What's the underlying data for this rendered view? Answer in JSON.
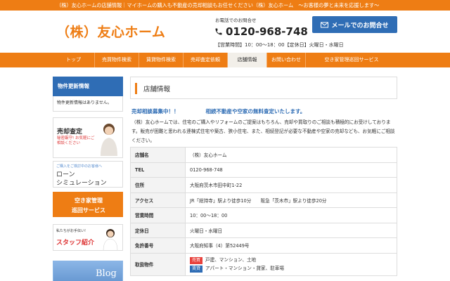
{
  "topbar": {
    "text": "（株）友心ホームの店舗情報｜マイホームの購入も不動産の売却相談もお任せください（株）友心ホーム　～お客様の夢と未来を応援します～"
  },
  "header": {
    "logo": "（株）友心ホーム",
    "tel_label": "お電話でのお問合せ",
    "tel": "0120-968-748",
    "hours": "【営業時間】10：00～18：00【定休日】火曜日・水曜日",
    "mail_button": "メールでのお問合せ"
  },
  "nav": {
    "items": [
      {
        "label": "トップ"
      },
      {
        "label": "売買物件検索"
      },
      {
        "label": "賃貸物件検索"
      },
      {
        "label": "売却査定依頼"
      },
      {
        "label": "店舗情報"
      },
      {
        "label": "お問い合わせ"
      },
      {
        "label": "空き家管理巡回サービス"
      }
    ],
    "active_index": 4
  },
  "sidebar": {
    "update_title": "物件更新情報",
    "update_body": "物件更新情報はありません。",
    "sale_title": "売却査定",
    "sale_sub": "秘密厳守! お気軽にご相談ください",
    "loan_note": "ご購入をご検討中のお客様へ",
    "loan_line1": "ローン",
    "loan_line2": "シミュレーション",
    "akiya_line1": "空き家管理",
    "akiya_line2": "巡回サービス",
    "staff_note": "私たちがお手伝い!",
    "staff_title": "スタッフ紹介",
    "blog_title": "Blog"
  },
  "main": {
    "title": "店舗情報",
    "lead_left": "売却相談募集中！！",
    "lead_right": "相続不動産や空家の無料査定いたします。",
    "description": "（株）友心ホームでは、住宅のご購入やリフォームのご提案はもちろん、売却や買取りのご相談も積極的にお受けしております。販売が困難と思われる連棟式住宅や築古、狭小住宅、また、相続登記が必要な不動産や空家の売却なども、お気軽にご相談ください。",
    "rows": [
      {
        "key": "店舗名",
        "value": "（株）友心ホーム"
      },
      {
        "key": "TEL",
        "value": "0120-968-748"
      },
      {
        "key": "住所",
        "value": "大阪府茨木市田中町1-22"
      },
      {
        "key": "アクセス",
        "value": "JR「総持寺」駅より徒歩10分　　阪急「茨木市」駅より徒歩20分"
      },
      {
        "key": "営業時間",
        "value": "10：00～18：00"
      },
      {
        "key": "定休日",
        "value": "火曜日・水曜日"
      },
      {
        "key": "免許番号",
        "value": "大阪府知事（4）第52449号"
      }
    ],
    "handling_key": "取扱物件",
    "handling_sale_tag": "売買",
    "handling_sale": "戸建、マンション、土地",
    "handling_rent_tag": "賃貸",
    "handling_rent": "アパート・マンション・貸家、駐車場"
  },
  "colors": {
    "accent": "#ee7d14",
    "brand_blue": "#2f6db5",
    "sale_red": "#e8413c"
  }
}
